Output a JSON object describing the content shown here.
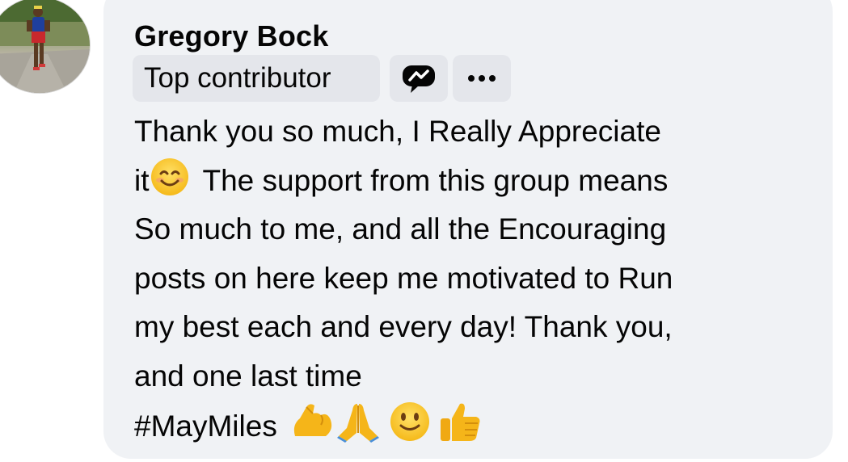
{
  "comment": {
    "author": "Gregory Bock",
    "badge": "Top contributor",
    "lines": [
      "Thank you so much, I Really Appreciate",
      "it",
      "The support from this group means",
      "So much to me, and all the Encouraging",
      "posts on here keep me motivated to Run",
      "my best each and every day! Thank you,",
      "and one last time",
      "#MayMiles"
    ],
    "inline_emoji": "smiling-face-with-smiling-eyes",
    "trailing_emojis": [
      "flexed-biceps",
      "folded-hands",
      "slightly-smiling-face",
      "thumbs-up"
    ]
  },
  "icons": {
    "message": "messenger-bubble-icon",
    "more": "more-options-icon"
  },
  "colors": {
    "bubble": "#f0f2f5",
    "badge": "#e4e6eb",
    "text": "#050505",
    "emoji_yellow": "#f7c31f"
  }
}
